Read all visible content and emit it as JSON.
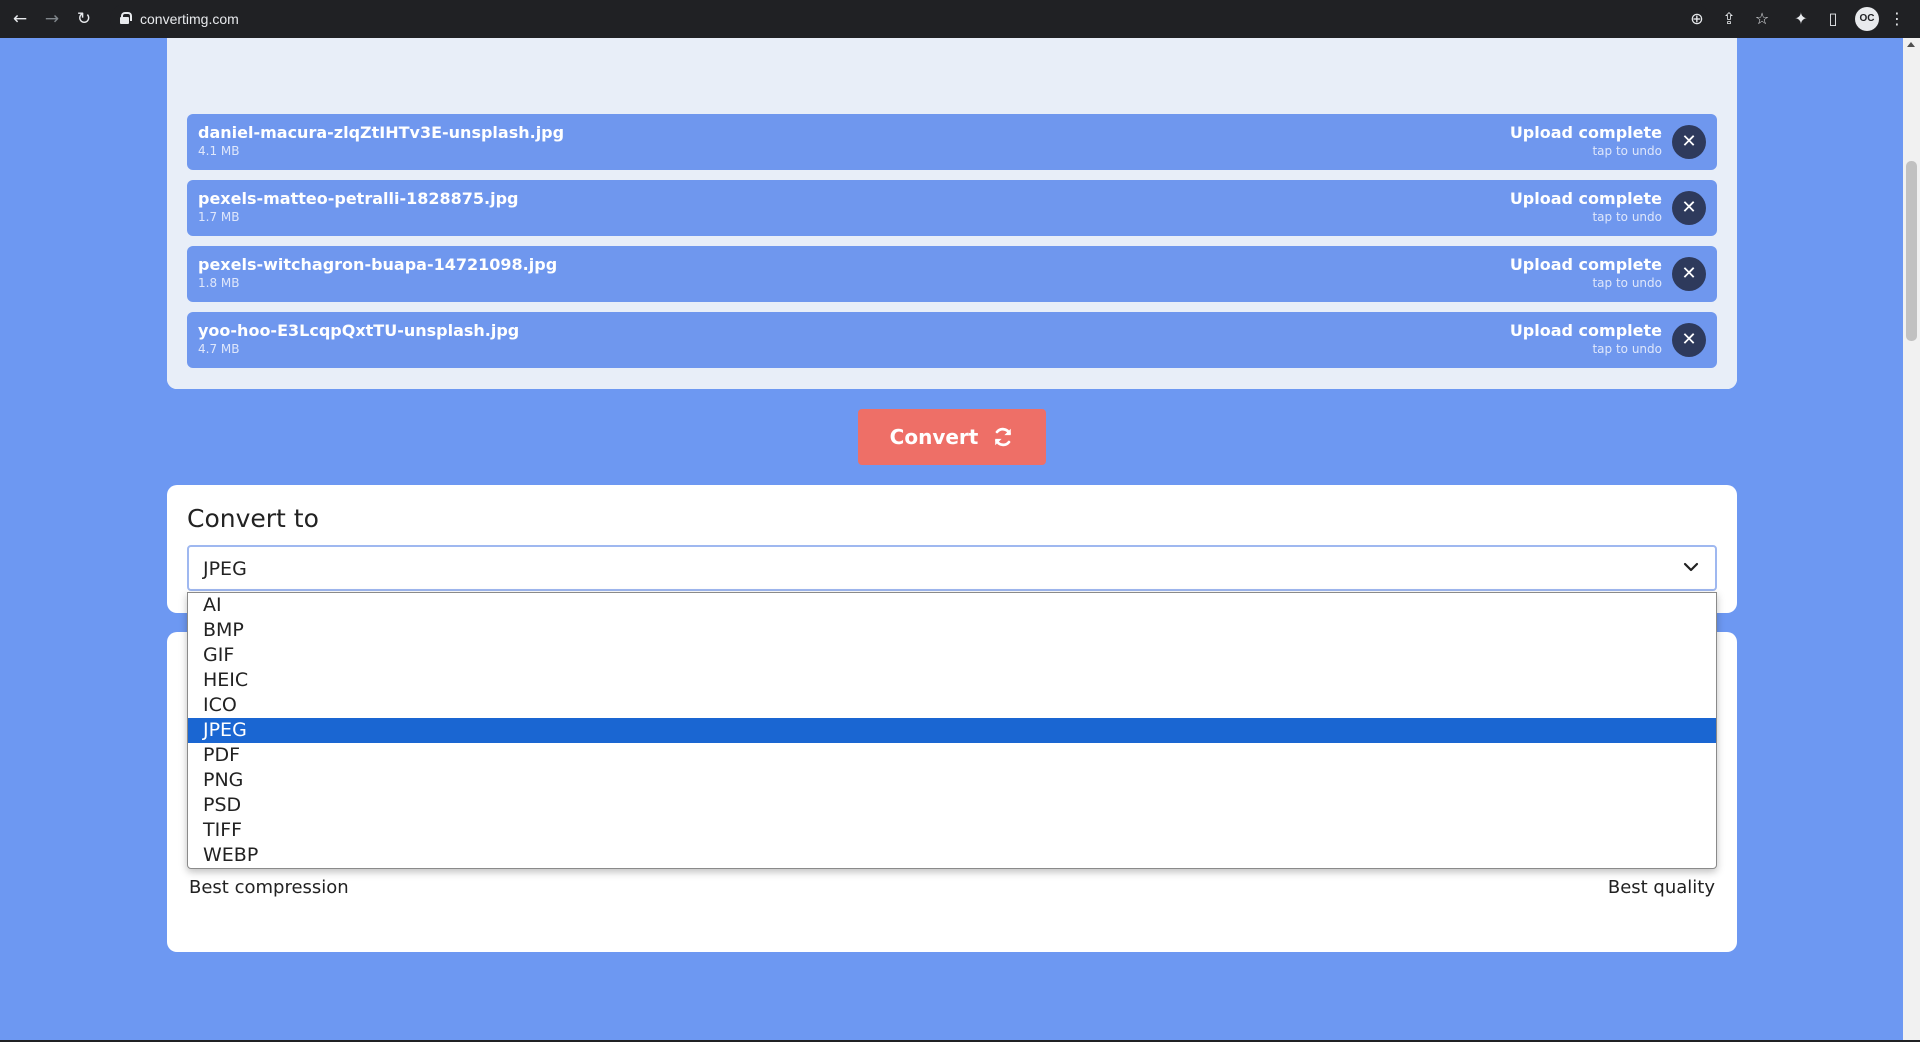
{
  "browser": {
    "url": "convertimg.com",
    "back_icon": "←",
    "forward_icon": "→",
    "reload_icon": "↻",
    "zoom_icon": "⊕",
    "share_icon": "⇪",
    "star_icon": "☆",
    "extensions_icon": "✦",
    "sidepanel_icon": "▯",
    "profile_label": "OC",
    "menu_icon": "⋮"
  },
  "files": [
    {
      "name": "daniel-macura-zlqZtIHTv3E-unsplash.jpg",
      "size": "4.1 MB",
      "status": "Upload complete",
      "sub": "tap to undo"
    },
    {
      "name": "pexels-matteo-petralli-1828875.jpg",
      "size": "1.7 MB",
      "status": "Upload complete",
      "sub": "tap to undo"
    },
    {
      "name": "pexels-witchagron-buapa-14721098.jpg",
      "size": "1.8 MB",
      "status": "Upload complete",
      "sub": "tap to undo"
    },
    {
      "name": "yoo-hoo-E3LcqpQxtTU-unsplash.jpg",
      "size": "4.7 MB",
      "status": "Upload complete",
      "sub": "tap to undo"
    }
  ],
  "remove_icon": "✕",
  "convert_button": {
    "label": "Convert"
  },
  "convert_to": {
    "title": "Convert to",
    "selected": "JPEG",
    "options": [
      "AI",
      "BMP",
      "GIF",
      "HEIC",
      "ICO",
      "JPEG",
      "PDF",
      "PNG",
      "PSD",
      "TIFF",
      "WEBP"
    ],
    "selected_index": 5
  },
  "quality": {
    "left_label": "Best compression",
    "right_label": "Best quality"
  },
  "colors": {
    "page_bg": "#6d98f2",
    "file_item_bg": "#6f97ee",
    "convert_button": "#ee6f67",
    "selected_option": "#1a66d2"
  }
}
